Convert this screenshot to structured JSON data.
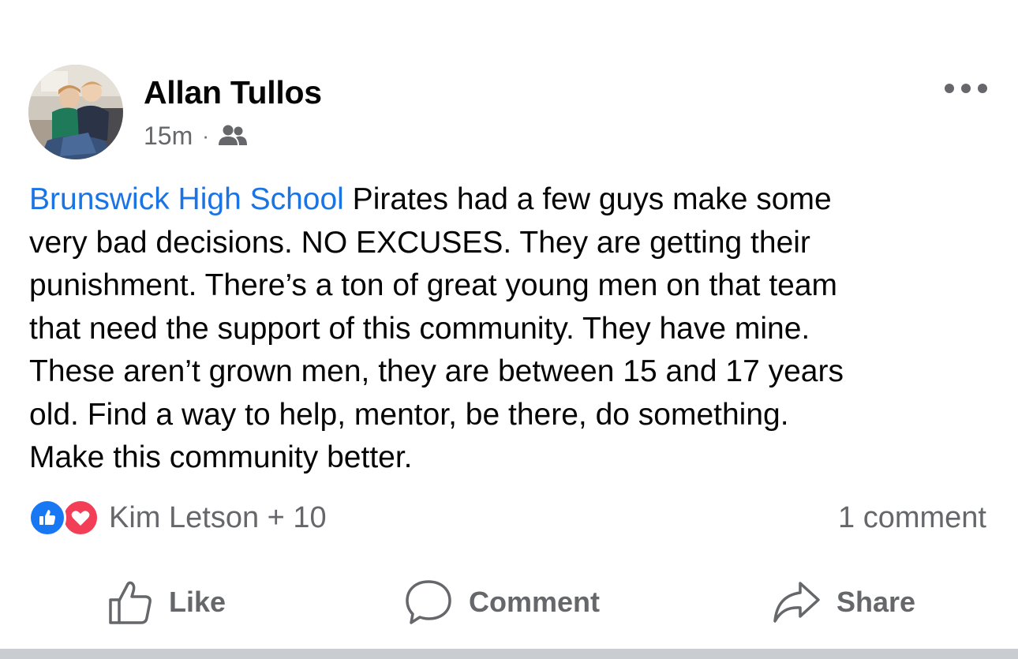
{
  "post": {
    "author": "Allan Tullos",
    "timestamp": "15m",
    "separator": "·",
    "audience_icon": "friends-icon",
    "more_icon": "more-horizontal-icon",
    "text": {
      "mention": "Brunswick High School",
      "lines": [
        " Pirates had a few guys make some",
        "very bad decisions. NO EXCUSES. They are getting their",
        "punishment. There’s a ton of great young men on that team",
        "that need the support of this community. They have mine.",
        "These aren’t grown men, they are between  15 and 17 years",
        "old.  Find a way to help, mentor, be there, do something.",
        "Make this community better."
      ]
    }
  },
  "reactions": {
    "types": [
      "like",
      "love"
    ],
    "summary": "Kim Letson + 10",
    "comment_count": "1 comment"
  },
  "actions": {
    "like_label": "Like",
    "comment_label": "Comment",
    "share_label": "Share"
  },
  "colors": {
    "mention": "#1b74e4",
    "like_blue": "#1877f2",
    "love_red": "#f33e58",
    "secondary_text": "#65676b"
  }
}
